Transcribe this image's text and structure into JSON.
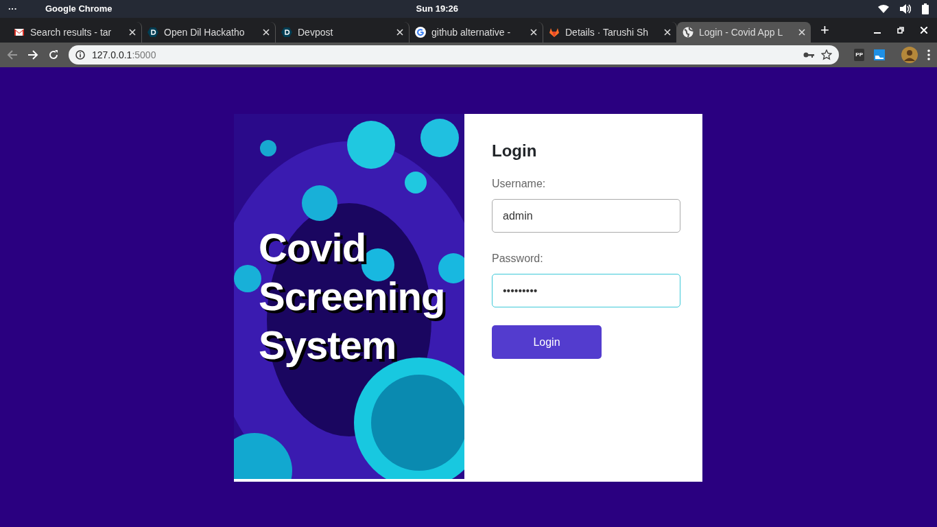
{
  "system_bar": {
    "menu": "···",
    "app": "Google Chrome",
    "clock": "Sun 19:26"
  },
  "tabs": [
    {
      "kind": "mail",
      "title": "Search results - tar",
      "selected": false
    },
    {
      "kind": "hex",
      "title": "Open Dil Hackatho",
      "selected": false
    },
    {
      "kind": "hex",
      "title": "Devpost",
      "selected": false
    },
    {
      "kind": "g",
      "title": "github alternative -",
      "selected": false
    },
    {
      "kind": "fox",
      "title": "Details · Tarushi Sh",
      "selected": false
    },
    {
      "kind": "globe",
      "title": "Login - Covid App L",
      "selected": true
    }
  ],
  "new_tab": "+",
  "address_bar": {
    "host": "127.0.0.1",
    "port": ":5000"
  },
  "extension": {
    "label": "PP"
  },
  "hero": {
    "title": "Covid Screening System"
  },
  "login": {
    "heading": "Login",
    "fields": [
      {
        "label": "Username:",
        "value": "admin",
        "focused": false
      },
      {
        "label": "Password:",
        "value": "•••••••••",
        "focused": true
      }
    ],
    "button": "Login"
  }
}
